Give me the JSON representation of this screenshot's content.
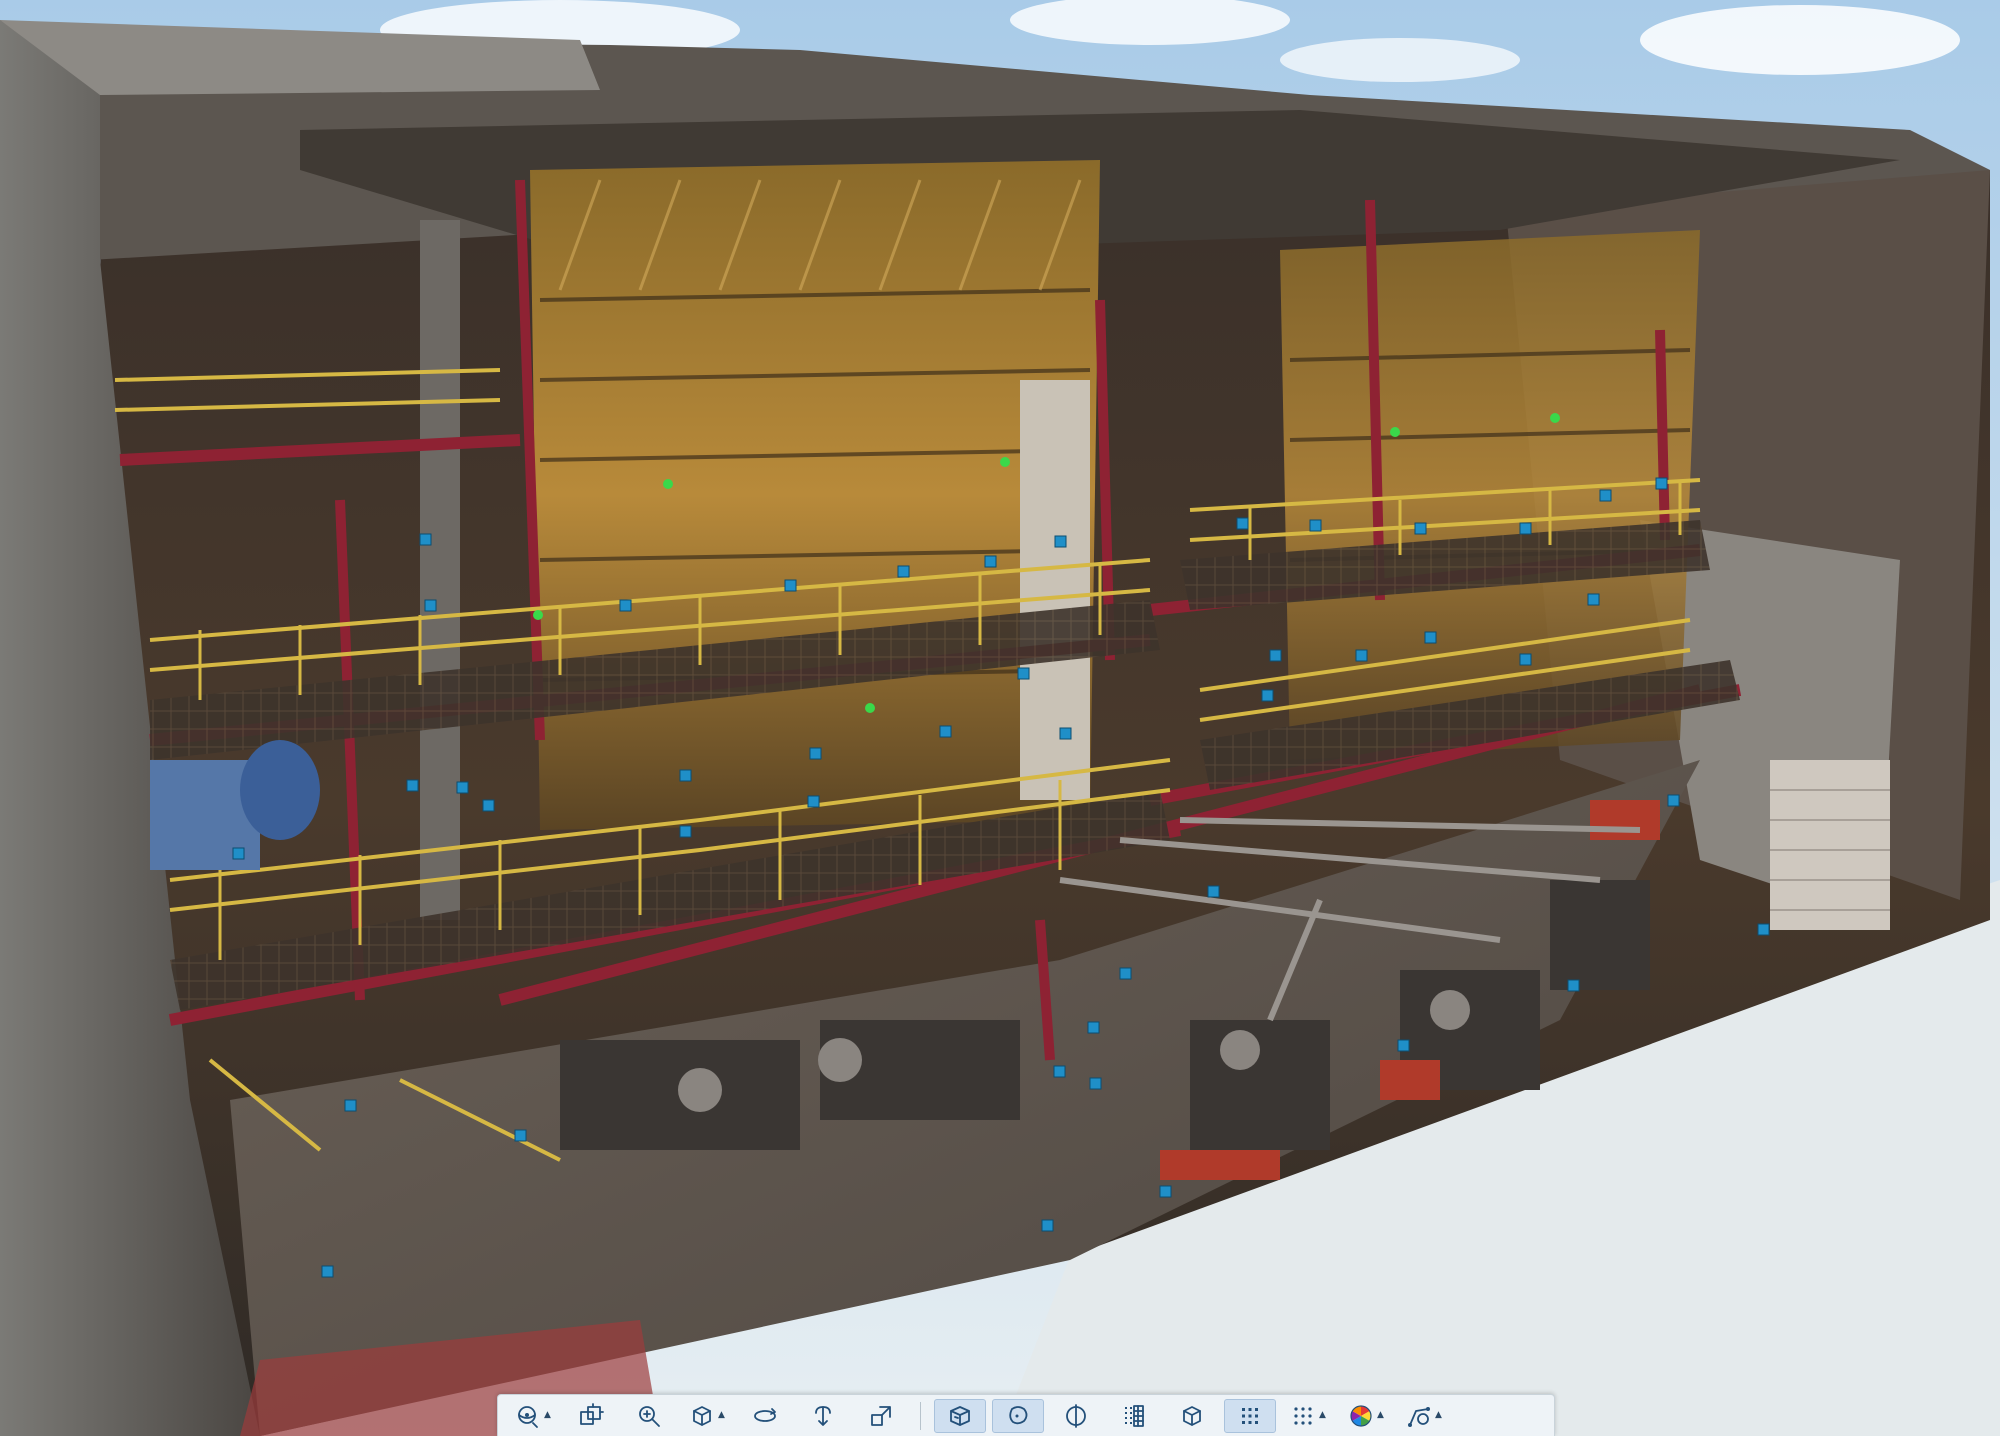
{
  "viewer": {
    "scene": "point-cloud-industrial-hall"
  },
  "toolbar": {
    "items": [
      {
        "id": "orbit",
        "icon": "orbit-icon",
        "has_menu": true,
        "active": false
      },
      {
        "id": "pan",
        "icon": "pan-icon",
        "has_menu": false,
        "active": false
      },
      {
        "id": "zoom",
        "icon": "zoom-icon",
        "has_menu": false,
        "active": false
      },
      {
        "id": "view-cube",
        "icon": "view-cube-icon",
        "has_menu": true,
        "active": false
      },
      {
        "id": "rotate",
        "icon": "rotate-icon",
        "has_menu": false,
        "active": false
      },
      {
        "id": "walk",
        "icon": "walk-icon",
        "has_menu": false,
        "active": false
      },
      {
        "id": "fly",
        "icon": "fly-icon",
        "has_menu": false,
        "active": false
      },
      {
        "id": "box-section",
        "icon": "box-section-icon",
        "has_menu": false,
        "active": true
      },
      {
        "id": "lasso-section",
        "icon": "lasso-icon",
        "has_menu": false,
        "active": true
      },
      {
        "id": "clip-plane",
        "icon": "clip-plane-icon",
        "has_menu": false,
        "active": false
      },
      {
        "id": "point-density",
        "icon": "density-icon",
        "has_menu": false,
        "active": false
      },
      {
        "id": "bounding-box",
        "icon": "bounding-box-icon",
        "has_menu": false,
        "active": false
      },
      {
        "id": "points-display",
        "icon": "points-icon",
        "has_menu": false,
        "active": true
      },
      {
        "id": "point-size",
        "icon": "point-size-icon",
        "has_menu": true,
        "active": false
      },
      {
        "id": "color-mode",
        "icon": "color-wheel-icon",
        "has_menu": true,
        "active": false
      },
      {
        "id": "measure",
        "icon": "measure-icon",
        "has_menu": true,
        "active": false
      }
    ]
  }
}
